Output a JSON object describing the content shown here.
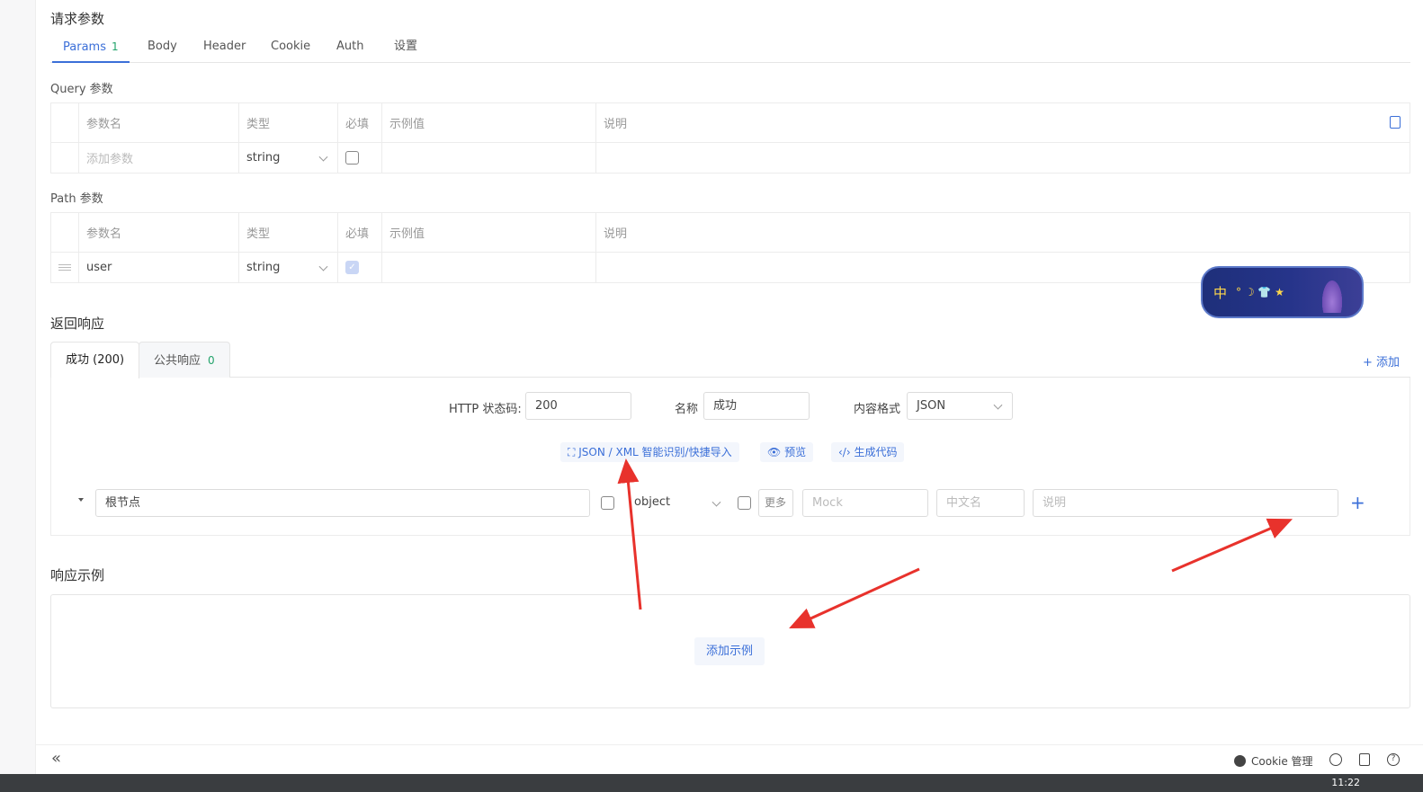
{
  "request": {
    "title": "请求参数",
    "tabs": [
      {
        "label": "Params",
        "count": "1"
      },
      {
        "label": "Body"
      },
      {
        "label": "Header"
      },
      {
        "label": "Cookie"
      },
      {
        "label": "Auth"
      },
      {
        "label": "设置"
      }
    ],
    "query": {
      "title": "Query 参数",
      "columns": [
        "参数名",
        "类型",
        "必填",
        "示例值",
        "说明"
      ],
      "row": {
        "name_placeholder": "添加参数",
        "type": "string",
        "required": false
      }
    },
    "path": {
      "title": "Path 参数",
      "columns": [
        "参数名",
        "类型",
        "必填",
        "示例值",
        "说明"
      ],
      "row": {
        "name": "user",
        "type": "string",
        "required": true
      }
    }
  },
  "response": {
    "title": "返回响应",
    "tabs": [
      {
        "label": "成功 (200)"
      },
      {
        "label": "公共响应",
        "count": "0"
      }
    ],
    "add_label": "+ 添加",
    "status_label": "HTTP 状态码:",
    "status_value": "200",
    "name_label": "名称",
    "name_value": "成功",
    "format_label": "内容格式",
    "format_value": "JSON",
    "actions": {
      "import": "JSON / XML 智能识别/快捷导入",
      "preview": "预览",
      "codegen": "生成代码"
    },
    "schema_row": {
      "name": "根节点",
      "type": "object",
      "more": "更多",
      "mock_placeholder": "Mock",
      "cn_name_placeholder": "中文名",
      "desc_placeholder": "说明",
      "add": "+"
    }
  },
  "example": {
    "title": "响应示例",
    "add_label": "添加示例"
  },
  "bottom_bar": {
    "collapse": "«",
    "cookie_label": "Cookie 管理"
  },
  "ime": {
    "char": "中",
    "symbols": "° ☽ 👕 ★"
  },
  "taskbar": {
    "clock": "11:22"
  },
  "colors": {
    "accent": "#3b6fd8",
    "count_green": "#23a36b",
    "arrow_red": "#e8322c"
  }
}
